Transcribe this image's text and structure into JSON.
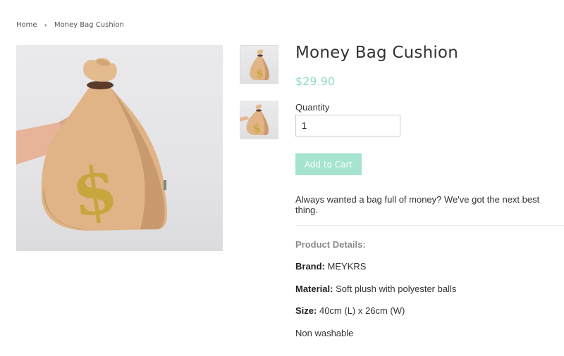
{
  "breadcrumb": {
    "home": "Home",
    "separator": "›",
    "current": "Money Bag Cushion"
  },
  "product": {
    "title": "Money Bag Cushion",
    "price": "$29.90",
    "quantity_label": "Quantity",
    "quantity_value": "1",
    "add_to_cart": "Add to Cart",
    "description": "Always wanted a bag full of money? We've got the next best thing.",
    "details_heading": "Product Details:",
    "details": [
      {
        "label": "Brand:",
        "value": "MEYKRS"
      },
      {
        "label": "Material:",
        "value": "Soft plush with polyester balls"
      },
      {
        "label": "Size:",
        "value": "40cm (L) x 26cm (W)"
      }
    ],
    "care": "Non washable"
  },
  "colors": {
    "accent": "#8fdcc0",
    "button": "#a5e5cf",
    "bag": "#e2b98c",
    "dollar": "#c8a63e"
  },
  "images": {
    "main": "money-bag-held-by-hand",
    "thumbnails": [
      "money-bag-thumbnail",
      "money-bag-thumbnail"
    ]
  }
}
